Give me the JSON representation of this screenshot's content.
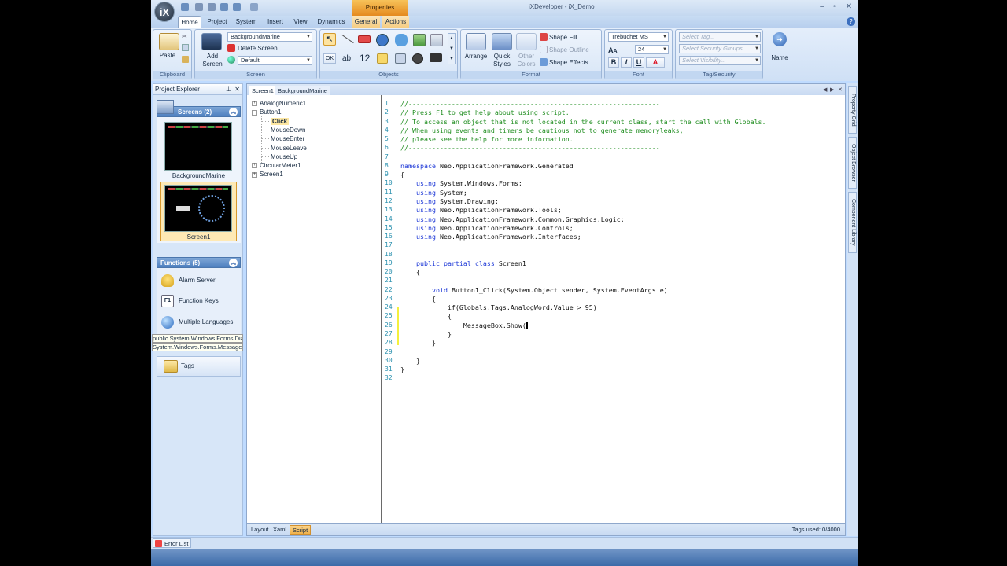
{
  "app": {
    "window_title": "iXDeveloper - iX_Demo",
    "logo_text": "iX",
    "context_tab_group": "Properties"
  },
  "tabs": [
    "Home",
    "Project",
    "System",
    "Insert",
    "View",
    "Dynamics",
    "General",
    "Actions"
  ],
  "ribbon": {
    "clipboard": {
      "label": "Clipboard",
      "paste": "Paste"
    },
    "screen": {
      "label": "Screen",
      "add_screen_line1": "Add",
      "add_screen_line2": "Screen",
      "background_combo": "BackgroundMarine",
      "delete_screen": "Delete Screen",
      "style_combo": "Default"
    },
    "objects": {
      "label": "Objects",
      "ok_text": "OK",
      "ab_text": "ab",
      "num_text": "12"
    },
    "format": {
      "label": "Format",
      "arrange": "Arrange",
      "quick_styles_1": "Quick",
      "quick_styles_2": "Styles",
      "other_colors_1": "Other",
      "other_colors_2": "Colors",
      "shape_fill": "Shape Fill",
      "shape_outline": "Shape Outline",
      "shape_effects": "Shape Effects"
    },
    "font": {
      "label": "Font",
      "family": "Trebuchet MS",
      "size": "24",
      "bold": "B",
      "italic": "I",
      "underline": "U",
      "color": "A"
    },
    "tag_security": {
      "label": "Tag/Security",
      "select_tag": "Select Tag...",
      "select_security": "Select Security Groups...",
      "select_visibility": "Select Visibility..."
    },
    "name": {
      "label": "Name"
    }
  },
  "project_explorer": {
    "title": "Project Explorer",
    "pin_icon": "pin-icon",
    "screens_header": "Screens (2)",
    "screens": [
      {
        "label": "BackgroundMarine"
      },
      {
        "label": "Screen1"
      }
    ],
    "functions_header": "Functions (5)",
    "functions": [
      {
        "label": "Alarm Server",
        "icon": "bell-icon"
      },
      {
        "label": "Function Keys",
        "icon": "f1-key-icon",
        "key": "F1"
      },
      {
        "label": "Multiple Languages",
        "icon": "globe-icon"
      }
    ],
    "tooltip_lines": [
      "public System.Windows.Forms.DialogResult Show(string text)",
      "System.Windows.Forms.MessageBox"
    ],
    "tags": "Tags"
  },
  "editor": {
    "doc_tabs": [
      "Screen1",
      "BackgroundMarine"
    ],
    "tree": [
      {
        "label": "AnalogNumeric1",
        "expander": "+",
        "level": 0
      },
      {
        "label": "Button1",
        "expander": "-",
        "level": 0
      },
      {
        "label": "Click",
        "level": 1,
        "selected": true
      },
      {
        "label": "MouseDown",
        "level": 1
      },
      {
        "label": "MouseEnter",
        "level": 1
      },
      {
        "label": "MouseLeave",
        "level": 1
      },
      {
        "label": "MouseUp",
        "level": 1
      },
      {
        "label": "CircularMeter1",
        "expander": "+",
        "level": 0
      },
      {
        "label": "Screen1",
        "expander": "+",
        "level": 0
      }
    ],
    "code_lines": [
      "//----------------------------------------------------------------",
      "// Press F1 to get help about using script.",
      "// To access an object that is not located in the current class, start the call with Globals.",
      "// When using events and timers be cautious not to generate memoryleaks,",
      "// please see the help for more information.",
      "//----------------------------------------------------------------",
      "",
      "namespace Neo.ApplicationFramework.Generated",
      "{",
      "    using System.Windows.Forms;",
      "    using System;",
      "    using System.Drawing;",
      "    using Neo.ApplicationFramework.Tools;",
      "    using Neo.ApplicationFramework.Common.Graphics.Logic;",
      "    using Neo.ApplicationFramework.Controls;",
      "    using Neo.ApplicationFramework.Interfaces;",
      "",
      "",
      "    public partial class Screen1",
      "    {",
      "",
      "        void Button1_Click(System.Object sender, System.EventArgs e)",
      "        {",
      "            if(Globals.Tags.AnalogWord.Value > 95)",
      "            {",
      "                MessageBox.Show(",
      "            }",
      "        }",
      "",
      "    }",
      "}",
      ""
    ],
    "bottom_tabs": [
      "Layout",
      "Xaml",
      "Script"
    ],
    "tags_used": "Tags used: 0/4000"
  },
  "right_tabs": [
    "Property Grid",
    "Object Browser",
    "Component Library"
  ],
  "status": {
    "error_list": "Error List"
  },
  "colors": {
    "accent": "#f0b24d",
    "comment": "#1d8c1d",
    "keyword": "#1a35d6",
    "line_number": "#2b91af"
  }
}
